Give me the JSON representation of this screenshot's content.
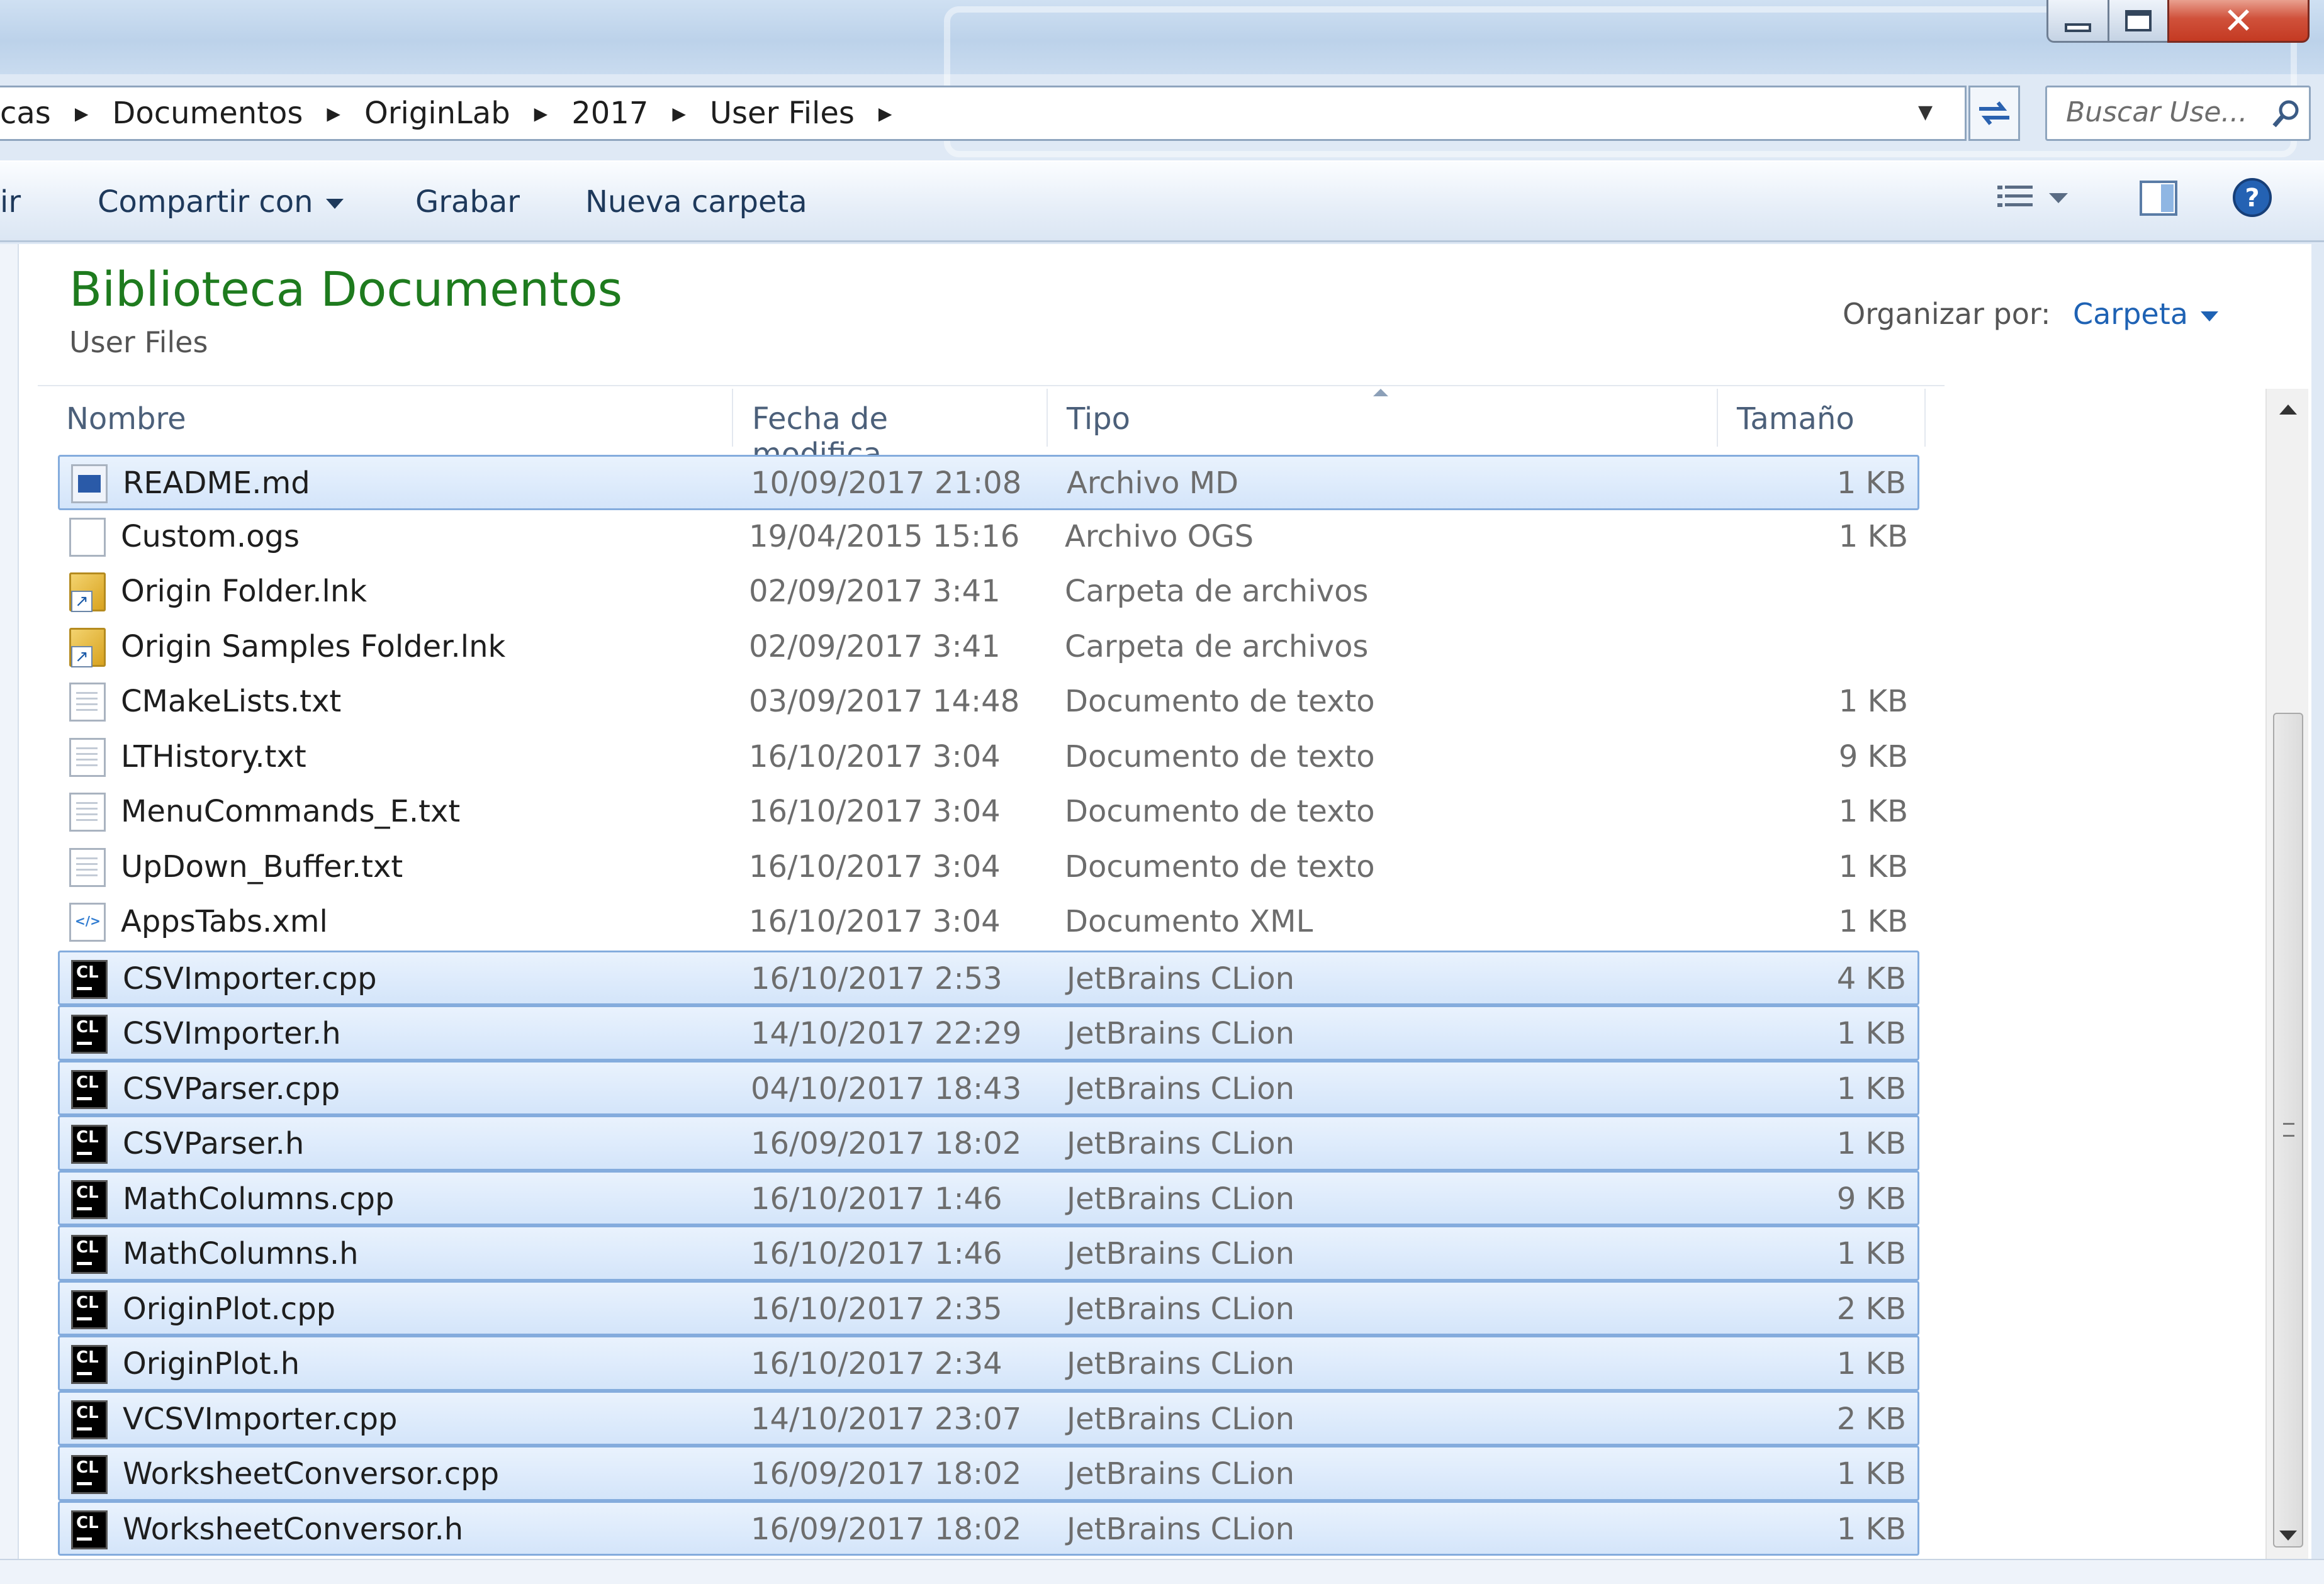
{
  "breadcrumbs": [
    "cas",
    "Documentos",
    "OriginLab",
    "2017",
    "User Files"
  ],
  "search": {
    "placeholder": "Buscar Use..."
  },
  "toolbar": {
    "cut_label": "ir",
    "share_label": "Compartir con",
    "record_label": "Grabar",
    "new_folder_label": "Nueva carpeta"
  },
  "library": {
    "title": "Biblioteca Documentos",
    "subtitle": "User Files",
    "arrange_label": "Organizar por:",
    "arrange_value": "Carpeta"
  },
  "columns": {
    "name": "Nombre",
    "date": "Fecha de modifica...",
    "type": "Tipo",
    "size": "Tamaño"
  },
  "files": [
    {
      "name": "README.md",
      "date": "10/09/2017 21:08",
      "type": "Archivo MD",
      "size": "1 KB",
      "icon": "md-file-icon",
      "selected": true
    },
    {
      "name": "Custom.ogs",
      "date": "19/04/2015 15:16",
      "type": "Archivo OGS",
      "size": "1 KB",
      "icon": "blank-file-icon",
      "selected": false
    },
    {
      "name": "Origin Folder.lnk",
      "date": "02/09/2017 3:41",
      "type": "Carpeta de archivos",
      "size": "",
      "icon": "shortcut-icon",
      "selected": false
    },
    {
      "name": "Origin Samples Folder.lnk",
      "date": "02/09/2017 3:41",
      "type": "Carpeta de archivos",
      "size": "",
      "icon": "shortcut-icon",
      "selected": false
    },
    {
      "name": "CMakeLists.txt",
      "date": "03/09/2017 14:48",
      "type": "Documento de texto",
      "size": "1 KB",
      "icon": "text-file-icon",
      "selected": false
    },
    {
      "name": "LTHistory.txt",
      "date": "16/10/2017 3:04",
      "type": "Documento de texto",
      "size": "9 KB",
      "icon": "text-file-icon",
      "selected": false
    },
    {
      "name": "MenuCommands_E.txt",
      "date": "16/10/2017 3:04",
      "type": "Documento de texto",
      "size": "1 KB",
      "icon": "text-file-icon",
      "selected": false
    },
    {
      "name": "UpDown_Buffer.txt",
      "date": "16/10/2017 3:04",
      "type": "Documento de texto",
      "size": "1 KB",
      "icon": "text-file-icon",
      "selected": false
    },
    {
      "name": "AppsTabs.xml",
      "date": "16/10/2017 3:04",
      "type": "Documento XML",
      "size": "1 KB",
      "icon": "xml-file-icon",
      "selected": false
    },
    {
      "name": "CSVImporter.cpp",
      "date": "16/10/2017 2:53",
      "type": "JetBrains CLion",
      "size": "4 KB",
      "icon": "clion-file-icon",
      "selected": true
    },
    {
      "name": "CSVImporter.h",
      "date": "14/10/2017 22:29",
      "type": "JetBrains CLion",
      "size": "1 KB",
      "icon": "clion-file-icon",
      "selected": true
    },
    {
      "name": "CSVParser.cpp",
      "date": "04/10/2017 18:43",
      "type": "JetBrains CLion",
      "size": "1 KB",
      "icon": "clion-file-icon",
      "selected": true
    },
    {
      "name": "CSVParser.h",
      "date": "16/09/2017 18:02",
      "type": "JetBrains CLion",
      "size": "1 KB",
      "icon": "clion-file-icon",
      "selected": true
    },
    {
      "name": "MathColumns.cpp",
      "date": "16/10/2017 1:46",
      "type": "JetBrains CLion",
      "size": "9 KB",
      "icon": "clion-file-icon",
      "selected": true
    },
    {
      "name": "MathColumns.h",
      "date": "16/10/2017 1:46",
      "type": "JetBrains CLion",
      "size": "1 KB",
      "icon": "clion-file-icon",
      "selected": true
    },
    {
      "name": "OriginPlot.cpp",
      "date": "16/10/2017 2:35",
      "type": "JetBrains CLion",
      "size": "2 KB",
      "icon": "clion-file-icon",
      "selected": true
    },
    {
      "name": "OriginPlot.h",
      "date": "16/10/2017 2:34",
      "type": "JetBrains CLion",
      "size": "1 KB",
      "icon": "clion-file-icon",
      "selected": true
    },
    {
      "name": "VCSVImporter.cpp",
      "date": "14/10/2017 23:07",
      "type": "JetBrains CLion",
      "size": "2 KB",
      "icon": "clion-file-icon",
      "selected": true
    },
    {
      "name": "WorksheetConversor.cpp",
      "date": "16/09/2017 18:02",
      "type": "JetBrains CLion",
      "size": "1 KB",
      "icon": "clion-file-icon",
      "selected": true
    },
    {
      "name": "WorksheetConversor.h",
      "date": "16/09/2017 18:02",
      "type": "JetBrains CLion",
      "size": "1 KB",
      "icon": "clion-file-icon",
      "selected": true
    }
  ],
  "colors": {
    "title_green": "#1e7b1e",
    "link_blue": "#1e62b4",
    "selection_fill": "#d4e5fa",
    "selection_border": "#84acdd"
  }
}
